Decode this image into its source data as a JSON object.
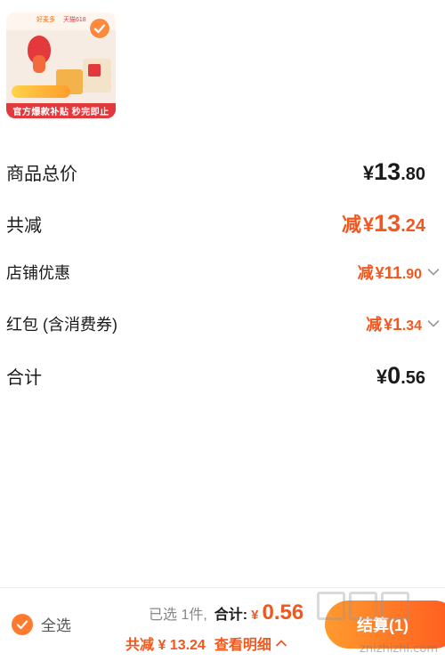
{
  "product": {
    "thumbnail": {
      "brand_left": "好麦多",
      "brand_right": "天猫618",
      "banner_text": "官方爆款补贴 秒完即止",
      "selected_icon": "check-icon"
    }
  },
  "summary": {
    "rows": [
      {
        "label": "商品总价",
        "prefix": "",
        "yen": "¥",
        "int": "13",
        "dec": ".80",
        "style": "black"
      },
      {
        "label": "共减",
        "prefix": "减",
        "yen": "¥",
        "int": "13",
        "dec": ".24",
        "style": "orange"
      },
      {
        "label": "店铺优惠",
        "prefix": "减",
        "yen": "¥",
        "int": "11",
        "dec": ".90",
        "style": "orange-small",
        "icon": "chevron-down-icon"
      },
      {
        "label": "红包 (含消费券)",
        "prefix": "减",
        "yen": "¥",
        "int": "1",
        "dec": ".34",
        "style": "orange-small",
        "icon": "chevron-down-icon"
      },
      {
        "label": "合计",
        "prefix": "",
        "yen": "¥",
        "int": "0",
        "dec": ".56",
        "style": "black"
      }
    ]
  },
  "bottom_bar": {
    "select_all_label": "全选",
    "selected_count_text": "已选 1件,",
    "total_label": "合计:",
    "total_yen": "¥",
    "total_value": "0.56",
    "discount_text": "共减 ¥ 13.24",
    "detail_label": "查看明细",
    "detail_icon": "chevron-up-icon",
    "checkout_label": "结算(1)"
  },
  "watermark": {
    "text": "znizhizhi.com"
  },
  "colors": {
    "accent": "#f2571d",
    "checkbox": "#ff7a2e",
    "banner": "#e4393c"
  }
}
